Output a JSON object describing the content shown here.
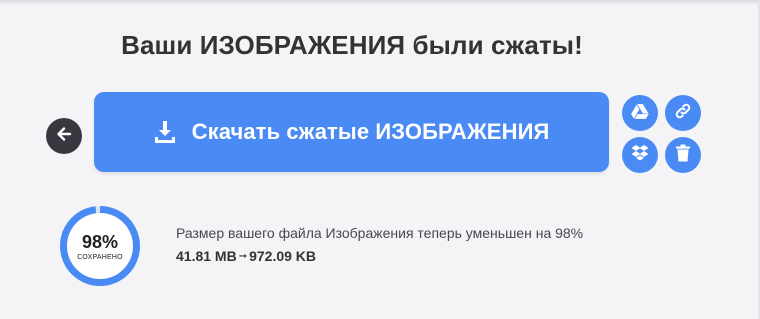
{
  "title": "Ваши ИЗОБРАЖЕНИЯ были сжаты!",
  "download_button": {
    "label": "Скачать сжатые ИЗОБРАЖЕНИЯ",
    "icon": "download-icon"
  },
  "actions": {
    "back_icon": "arrow-left-icon",
    "gdrive_icon": "google-drive-icon",
    "link_icon": "link-icon",
    "dropbox_icon": "dropbox-icon",
    "trash_icon": "trash-icon"
  },
  "result": {
    "percent": "98%",
    "percent_value": 0.98,
    "saved_label": "СОХРАНЕНО",
    "message": "Размер вашего файла Изображения теперь уменьшен на 98%",
    "original_size": "41.81 MB",
    "arrow": "➞",
    "compressed_size": "972.09 KB"
  },
  "colors": {
    "primary": "#4a8af4",
    "ring_track": "#dfe4ee",
    "dark_button": "#383840",
    "background": "#f4f4f7"
  }
}
